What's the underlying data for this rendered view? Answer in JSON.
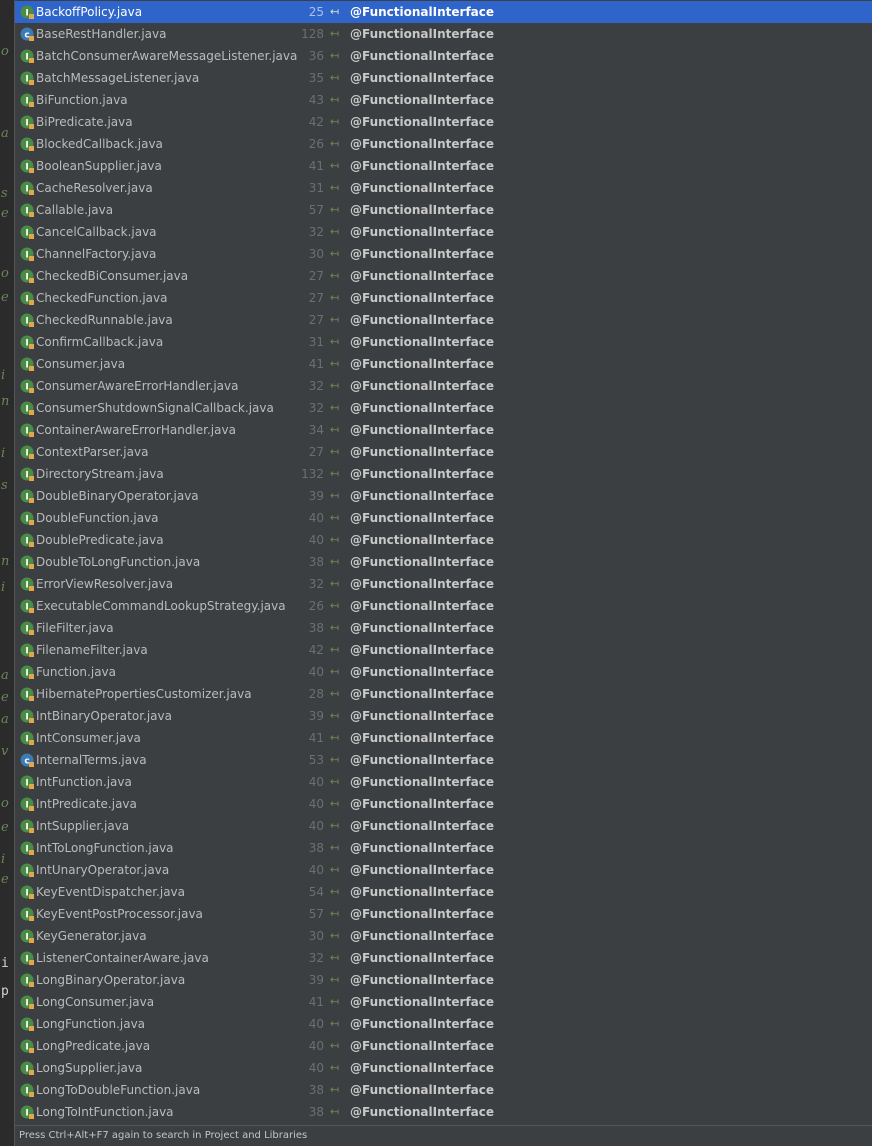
{
  "editor_gutter": {
    "letters": [
      "o",
      "a",
      "s",
      "e",
      "o",
      "e",
      "i",
      "n",
      "i",
      "s",
      "n",
      "i",
      "a",
      "e",
      "a",
      "v",
      "o",
      "e",
      "i",
      "e"
    ],
    "plain": [
      "i",
      "p"
    ]
  },
  "icons": {
    "interface": "interface-icon",
    "class": "class-icon",
    "interface_color": "#4a8b46",
    "class_color": "#3c7bb4",
    "arrow": "navigate-arrow-icon"
  },
  "results": [
    {
      "file": "BackoffPolicy.java",
      "line": "25",
      "annotation": "@FunctionalInterface",
      "icon": "interface",
      "selected": true
    },
    {
      "file": "BaseRestHandler.java",
      "line": "128",
      "annotation": "@FunctionalInterface",
      "icon": "class"
    },
    {
      "file": "BatchConsumerAwareMessageListener.java",
      "line": "36",
      "annotation": "@FunctionalInterface",
      "icon": "interface"
    },
    {
      "file": "BatchMessageListener.java",
      "line": "35",
      "annotation": "@FunctionalInterface",
      "icon": "interface"
    },
    {
      "file": "BiFunction.java",
      "line": "43",
      "annotation": "@FunctionalInterface",
      "icon": "interface"
    },
    {
      "file": "BiPredicate.java",
      "line": "42",
      "annotation": "@FunctionalInterface",
      "icon": "interface"
    },
    {
      "file": "BlockedCallback.java",
      "line": "26",
      "annotation": "@FunctionalInterface",
      "icon": "interface"
    },
    {
      "file": "BooleanSupplier.java",
      "line": "41",
      "annotation": "@FunctionalInterface",
      "icon": "interface"
    },
    {
      "file": "CacheResolver.java",
      "line": "31",
      "annotation": "@FunctionalInterface",
      "icon": "interface"
    },
    {
      "file": "Callable.java",
      "line": "57",
      "annotation": "@FunctionalInterface",
      "icon": "interface"
    },
    {
      "file": "CancelCallback.java",
      "line": "32",
      "annotation": "@FunctionalInterface",
      "icon": "interface"
    },
    {
      "file": "ChannelFactory.java",
      "line": "30",
      "annotation": "@FunctionalInterface",
      "icon": "interface"
    },
    {
      "file": "CheckedBiConsumer.java",
      "line": "27",
      "annotation": "@FunctionalInterface",
      "icon": "interface"
    },
    {
      "file": "CheckedFunction.java",
      "line": "27",
      "annotation": "@FunctionalInterface",
      "icon": "interface"
    },
    {
      "file": "CheckedRunnable.java",
      "line": "27",
      "annotation": "@FunctionalInterface",
      "icon": "interface"
    },
    {
      "file": "ConfirmCallback.java",
      "line": "31",
      "annotation": "@FunctionalInterface",
      "icon": "interface"
    },
    {
      "file": "Consumer.java",
      "line": "41",
      "annotation": "@FunctionalInterface",
      "icon": "interface"
    },
    {
      "file": "ConsumerAwareErrorHandler.java",
      "line": "32",
      "annotation": "@FunctionalInterface",
      "icon": "interface"
    },
    {
      "file": "ConsumerShutdownSignalCallback.java",
      "line": "32",
      "annotation": "@FunctionalInterface",
      "icon": "interface"
    },
    {
      "file": "ContainerAwareErrorHandler.java",
      "line": "34",
      "annotation": "@FunctionalInterface",
      "icon": "interface"
    },
    {
      "file": "ContextParser.java",
      "line": "27",
      "annotation": "@FunctionalInterface",
      "icon": "interface"
    },
    {
      "file": "DirectoryStream.java",
      "line": "132",
      "annotation": "@FunctionalInterface",
      "icon": "interface"
    },
    {
      "file": "DoubleBinaryOperator.java",
      "line": "39",
      "annotation": "@FunctionalInterface",
      "icon": "interface"
    },
    {
      "file": "DoubleFunction.java",
      "line": "40",
      "annotation": "@FunctionalInterface",
      "icon": "interface"
    },
    {
      "file": "DoublePredicate.java",
      "line": "40",
      "annotation": "@FunctionalInterface",
      "icon": "interface"
    },
    {
      "file": "DoubleToLongFunction.java",
      "line": "38",
      "annotation": "@FunctionalInterface",
      "icon": "interface"
    },
    {
      "file": "ErrorViewResolver.java",
      "line": "32",
      "annotation": "@FunctionalInterface",
      "icon": "interface"
    },
    {
      "file": "ExecutableCommandLookupStrategy.java",
      "line": "26",
      "annotation": "@FunctionalInterface",
      "icon": "interface"
    },
    {
      "file": "FileFilter.java",
      "line": "38",
      "annotation": "@FunctionalInterface",
      "icon": "interface"
    },
    {
      "file": "FilenameFilter.java",
      "line": "42",
      "annotation": "@FunctionalInterface",
      "icon": "interface"
    },
    {
      "file": "Function.java",
      "line": "40",
      "annotation": "@FunctionalInterface",
      "icon": "interface"
    },
    {
      "file": "HibernatePropertiesCustomizer.java",
      "line": "28",
      "annotation": "@FunctionalInterface",
      "icon": "interface"
    },
    {
      "file": "IntBinaryOperator.java",
      "line": "39",
      "annotation": "@FunctionalInterface",
      "icon": "interface"
    },
    {
      "file": "IntConsumer.java",
      "line": "41",
      "annotation": "@FunctionalInterface",
      "icon": "interface"
    },
    {
      "file": "InternalTerms.java",
      "line": "53",
      "annotation": "@FunctionalInterface",
      "icon": "class"
    },
    {
      "file": "IntFunction.java",
      "line": "40",
      "annotation": "@FunctionalInterface",
      "icon": "interface"
    },
    {
      "file": "IntPredicate.java",
      "line": "40",
      "annotation": "@FunctionalInterface",
      "icon": "interface"
    },
    {
      "file": "IntSupplier.java",
      "line": "40",
      "annotation": "@FunctionalInterface",
      "icon": "interface"
    },
    {
      "file": "IntToLongFunction.java",
      "line": "38",
      "annotation": "@FunctionalInterface",
      "icon": "interface"
    },
    {
      "file": "IntUnaryOperator.java",
      "line": "40",
      "annotation": "@FunctionalInterface",
      "icon": "interface"
    },
    {
      "file": "KeyEventDispatcher.java",
      "line": "54",
      "annotation": "@FunctionalInterface",
      "icon": "interface"
    },
    {
      "file": "KeyEventPostProcessor.java",
      "line": "57",
      "annotation": "@FunctionalInterface",
      "icon": "interface"
    },
    {
      "file": "KeyGenerator.java",
      "line": "30",
      "annotation": "@FunctionalInterface",
      "icon": "interface"
    },
    {
      "file": "ListenerContainerAware.java",
      "line": "32",
      "annotation": "@FunctionalInterface",
      "icon": "interface"
    },
    {
      "file": "LongBinaryOperator.java",
      "line": "39",
      "annotation": "@FunctionalInterface",
      "icon": "interface"
    },
    {
      "file": "LongConsumer.java",
      "line": "41",
      "annotation": "@FunctionalInterface",
      "icon": "interface"
    },
    {
      "file": "LongFunction.java",
      "line": "40",
      "annotation": "@FunctionalInterface",
      "icon": "interface"
    },
    {
      "file": "LongPredicate.java",
      "line": "40",
      "annotation": "@FunctionalInterface",
      "icon": "interface"
    },
    {
      "file": "LongSupplier.java",
      "line": "40",
      "annotation": "@FunctionalInterface",
      "icon": "interface"
    },
    {
      "file": "LongToDoubleFunction.java",
      "line": "38",
      "annotation": "@FunctionalInterface",
      "icon": "interface"
    },
    {
      "file": "LongToIntFunction.java",
      "line": "38",
      "annotation": "@FunctionalInterface",
      "icon": "interface"
    }
  ],
  "status": {
    "hint": "Press Ctrl+Alt+F7 again to search in Project and Libraries"
  }
}
